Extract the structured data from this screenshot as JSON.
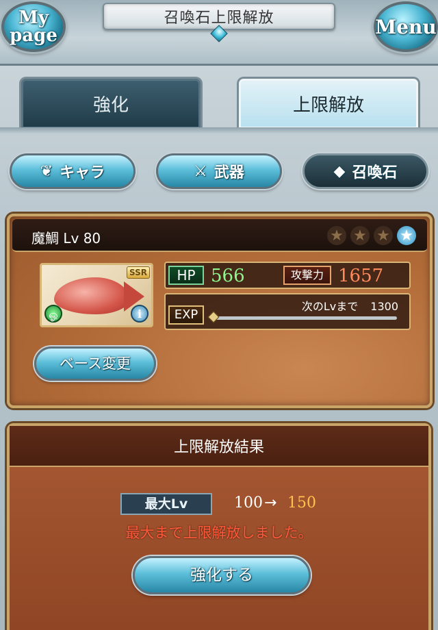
{
  "header": {
    "title": "召喚石上限解放",
    "mypage_label": "My page",
    "menu_label": "Menu"
  },
  "tabs": [
    {
      "label": "強化",
      "active": false
    },
    {
      "label": "上限解放",
      "active": true
    }
  ],
  "categories": [
    {
      "label": "キャラ",
      "icon": "character-icon",
      "selected": false
    },
    {
      "label": "武器",
      "icon": "weapon-icon",
      "selected": false
    },
    {
      "label": "召喚石",
      "icon": "summon-stone-icon",
      "selected": true
    }
  ],
  "summon": {
    "name_level": "魔鯛 Lv 80",
    "rarity": "SSR",
    "element_icon": "wind-element-icon",
    "stars_total": 4,
    "stars_lit": 1,
    "hp_label": "HP",
    "hp": "566",
    "atk_label": "攻撃力",
    "atk": "1657",
    "exp_label": "EXP",
    "exp_next_label": "次のLvまで",
    "exp_next_value": "1300",
    "exp_progress": 0.0,
    "base_change_label": "ベース変更"
  },
  "result": {
    "title": "上限解放結果",
    "max_lv_label": "最大Lv",
    "from_lv": "100",
    "arrow": "→",
    "to_lv": "150",
    "message": "最大まで上限解放しました。",
    "enhance_label": "強化する"
  },
  "colors": {
    "accent_blue": "#5dbfda",
    "panel_brown": "#b06a38",
    "gold_border": "#c9a56a",
    "hp_green": "#8ff58d",
    "atk_orange": "#ff8a5c",
    "lv_to_color": "#ffc34d",
    "message_red": "#ff5a3a"
  }
}
